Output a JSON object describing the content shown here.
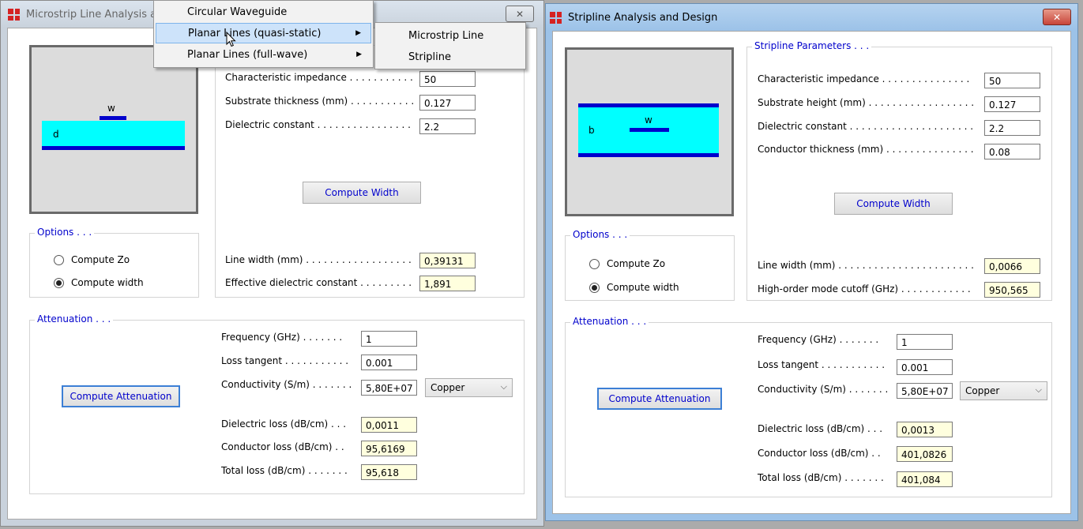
{
  "left_window": {
    "title": "Microstrip Line Analysis and Design",
    "close_glyph": "✕",
    "diagram": {
      "w_label": "w",
      "d_label": "d"
    },
    "params": [
      {
        "label": "Characteristic impedance . . . . . . . . . . .",
        "value": "50"
      },
      {
        "label": "Substrate thickness (mm) . . . . . . . . . . .",
        "value": "0.127"
      },
      {
        "label": "Dielectric constant . . . . . . . . . . . . . . . .",
        "value": "2.2"
      }
    ],
    "compute_width_label": "Compute Width",
    "results": [
      {
        "label": "Line width (mm) . . . . . . . . . . . . . . . . . .",
        "value": "0,39131"
      },
      {
        "label": "Effective dielectric constant . . . . . . . . .",
        "value": "1,891"
      }
    ],
    "options_legend": "Options . . .",
    "options": [
      {
        "label": "Compute Zo",
        "selected": false
      },
      {
        "label": "Compute width",
        "selected": true
      }
    ],
    "attenuation_legend": "Attenuation . . .",
    "compute_attenuation_label": "Compute Attenuation",
    "att_inputs": [
      {
        "label": "Frequency (GHz) . . . . . . .",
        "value": "1"
      },
      {
        "label": "Loss tangent . . . . . . . . . . .",
        "value": "0.001"
      },
      {
        "label": "Conductivity (S/m) . . . . . . .",
        "value": "5,80E+07"
      }
    ],
    "material": "Copper",
    "att_results": [
      {
        "label": "Dielectric loss (dB/cm) . . .",
        "value": "0,0011"
      },
      {
        "label": "Conductor loss (dB/cm) . .",
        "value": "95,6169"
      },
      {
        "label": "Total loss (dB/cm) . . . . . . .",
        "value": "95,618"
      }
    ]
  },
  "right_window": {
    "title": "Stripline Analysis and Design",
    "close_glyph": "✕",
    "diagram": {
      "w_label": "w",
      "b_label": "b"
    },
    "params_legend": "Stripline Parameters . . .",
    "params": [
      {
        "label": "Characteristic impedance . . . . . . . . . . . . . . .",
        "value": "50"
      },
      {
        "label": "Substrate height (mm) . . . . . . . . . . . . . . . . . .",
        "value": "0.127"
      },
      {
        "label": "Dielectric constant . . . . . . . . . . . . . . . . . . . . .",
        "value": "2.2"
      },
      {
        "label": "Conductor thickness (mm) . . . . . . . . . . . . . . .",
        "value": "0.08"
      }
    ],
    "compute_width_label": "Compute Width",
    "results": [
      {
        "label": "Line width (mm) . . . . . . . . . . . . . . . . . . . . . . .",
        "value": "0,0066"
      },
      {
        "label": "High-order mode cutoff (GHz) . . . . . . . . . . . .",
        "value": "950,565"
      }
    ],
    "options_legend": "Options . . .",
    "options": [
      {
        "label": "Compute Zo",
        "selected": false
      },
      {
        "label": "Compute width",
        "selected": true
      }
    ],
    "attenuation_legend": "Attenuation . . .",
    "compute_attenuation_label": "Compute Attenuation",
    "att_inputs": [
      {
        "label": "Frequency (GHz) . . . . . . .",
        "value": "1"
      },
      {
        "label": "Loss tangent . . . . . . . . . . .",
        "value": "0.001"
      },
      {
        "label": "Conductivity (S/m) . . . . . . .",
        "value": "5,80E+07"
      }
    ],
    "material": "Copper",
    "att_results": [
      {
        "label": "Dielectric loss (dB/cm) . . .",
        "value": "0,0013"
      },
      {
        "label": "Conductor loss (dB/cm) . .",
        "value": "401,0826"
      },
      {
        "label": "Total loss (dB/cm) . . . . . . .",
        "value": "401,084"
      }
    ]
  },
  "menu": {
    "items": [
      {
        "label": "Circular Waveguide"
      },
      {
        "label": "Planar Lines (quasi-static)"
      },
      {
        "label": "Planar Lines (full-wave)"
      }
    ],
    "submenu": [
      {
        "label": "Microstrip Line"
      },
      {
        "label": "Stripline"
      }
    ]
  },
  "icons": {
    "submenu_arrow": "▶",
    "dropdown_chevron": "⌵"
  },
  "colors": {
    "dielectric": "#00ffff",
    "conductor": "#0000cc",
    "legend_text": "#0000cc",
    "readonly_bg": "#ffffde",
    "app_icon": "#d52222"
  }
}
